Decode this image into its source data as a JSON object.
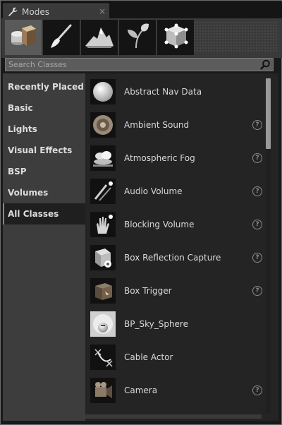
{
  "window": {
    "tab_title": "Modes",
    "tab_icon": "wrench-icon",
    "close_glyph": "×"
  },
  "modes": [
    {
      "name": "place-mode",
      "icon": "cube-cylinder-icon",
      "active": true
    },
    {
      "name": "paint-mode",
      "icon": "brush-icon",
      "active": false
    },
    {
      "name": "landscape-mode",
      "icon": "mountain-icon",
      "active": false
    },
    {
      "name": "foliage-mode",
      "icon": "leaf-icon",
      "active": false
    },
    {
      "name": "geometry-mode",
      "icon": "geometry-box-icon",
      "active": false
    }
  ],
  "search": {
    "placeholder": "Search Classes",
    "value": ""
  },
  "categories": [
    {
      "label": "Recently Placed",
      "selected": false
    },
    {
      "label": "Basic",
      "selected": false
    },
    {
      "label": "Lights",
      "selected": false
    },
    {
      "label": "Visual Effects",
      "selected": false
    },
    {
      "label": "BSP",
      "selected": false
    },
    {
      "label": "Volumes",
      "selected": false
    },
    {
      "label": "All Classes",
      "selected": true
    }
  ],
  "items": [
    {
      "label": "Abstract Nav Data",
      "icon": "sphere-icon",
      "help": false
    },
    {
      "label": "Ambient Sound",
      "icon": "speaker-icon",
      "help": true
    },
    {
      "label": "Atmospheric Fog",
      "icon": "cloud-icon",
      "help": true
    },
    {
      "label": "Audio Volume",
      "icon": "volume-icon",
      "help": true
    },
    {
      "label": "Blocking Volume",
      "icon": "hand-icon",
      "help": true
    },
    {
      "label": "Box Reflection Capture",
      "icon": "reflection-capture-icon",
      "help": true
    },
    {
      "label": "Box Trigger",
      "icon": "box-trigger-icon",
      "help": true
    },
    {
      "label": "BP_Sky_Sphere",
      "icon": "sky-sphere-icon",
      "help": false
    },
    {
      "label": "Cable Actor",
      "icon": "cable-icon",
      "help": false
    },
    {
      "label": "Camera",
      "icon": "camera-icon",
      "help": true
    }
  ],
  "help_glyph": "?",
  "scrollbar": {
    "position_fraction": 0.0,
    "visible_fraction": 0.21
  }
}
